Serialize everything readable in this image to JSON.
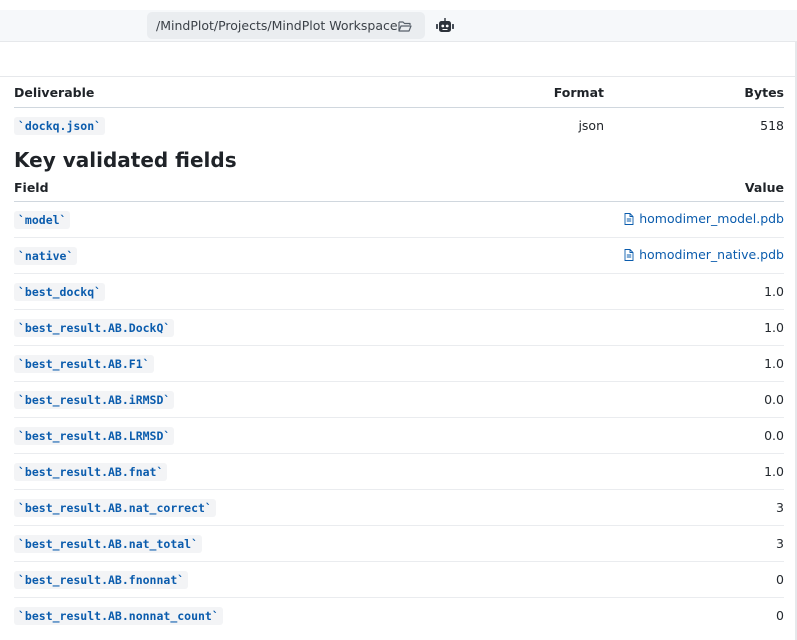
{
  "toolbar": {
    "path": "/MindPlot/Projects/MindPlot Workspace",
    "folder_icon": "folder-open-icon",
    "bot_icon": "robot-icon"
  },
  "deliverables": {
    "columns": [
      "Deliverable",
      "Format",
      "Bytes"
    ],
    "rows": [
      {
        "name": "`dockq.json`",
        "format": "json",
        "bytes": "518"
      }
    ]
  },
  "key_fields": {
    "heading": "Key validated fields",
    "columns": [
      "Field",
      "Value"
    ],
    "rows": [
      {
        "field": "`model`",
        "value": "homodimer_model.pdb",
        "is_file": true
      },
      {
        "field": "`native`",
        "value": "homodimer_native.pdb",
        "is_file": true
      },
      {
        "field": "`best_dockq`",
        "value": "1.0"
      },
      {
        "field": "`best_result.AB.DockQ`",
        "value": "1.0"
      },
      {
        "field": "`best_result.AB.F1`",
        "value": "1.0"
      },
      {
        "field": "`best_result.AB.iRMSD`",
        "value": "0.0"
      },
      {
        "field": "`best_result.AB.LRMSD`",
        "value": "0.0"
      },
      {
        "field": "`best_result.AB.fnat`",
        "value": "1.0"
      },
      {
        "field": "`best_result.AB.nat_correct`",
        "value": "3"
      },
      {
        "field": "`best_result.AB.nat_total`",
        "value": "3"
      },
      {
        "field": "`best_result.AB.fnonnat`",
        "value": "0"
      },
      {
        "field": "`best_result.AB.nonnat_count`",
        "value": "0"
      }
    ]
  }
}
